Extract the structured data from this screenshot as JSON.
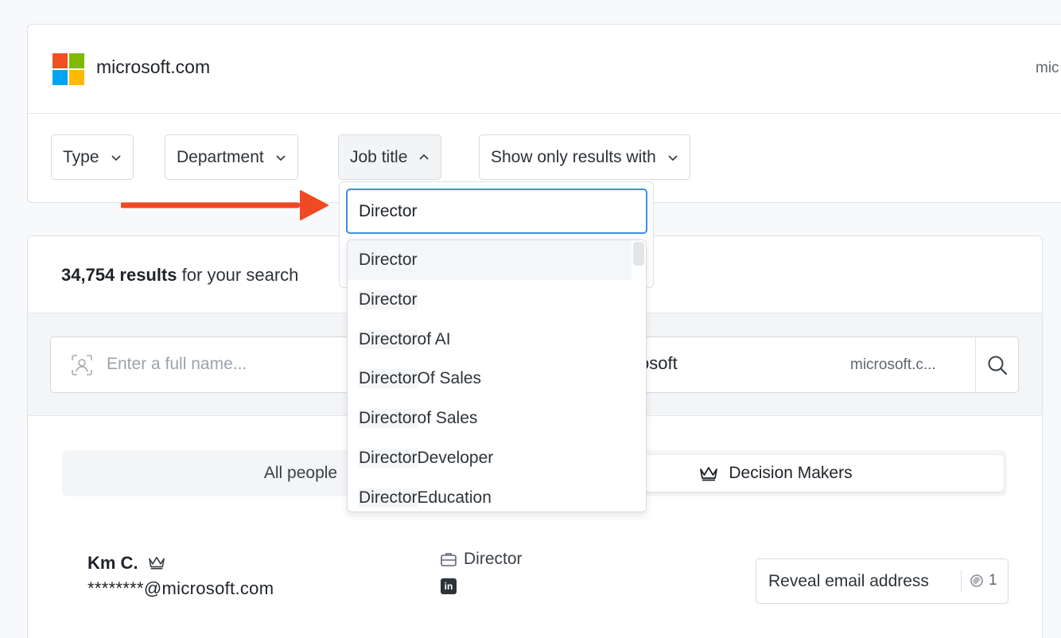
{
  "company": {
    "name": "microsoft.com",
    "domain_truncated": "mic",
    "logo_colors": [
      "#f25022",
      "#7fba00",
      "#00a4ef",
      "#ffb900"
    ]
  },
  "filters": {
    "type": "Type",
    "department": "Department",
    "job_title": "Job title",
    "show_only": "Show only results with"
  },
  "results": {
    "count": "34,754 results",
    "suffix": " for your search"
  },
  "search": {
    "name_placeholder": "Enter a full name...",
    "company_value": "osoft",
    "domain_value": "microsoft.c..."
  },
  "tabs": {
    "all": "All people",
    "decision_makers": "Decision Makers"
  },
  "person": {
    "name": "Km C.",
    "email": "********@microsoft.com",
    "title": "Director",
    "linkedin": "in",
    "reveal_label": "Reveal email address",
    "credit_cost": "1"
  },
  "job_title_dropdown": {
    "search_value": "Director",
    "options": [
      {
        "match": "Director",
        "rest": ""
      },
      {
        "match": "Director",
        "rest": ""
      },
      {
        "match": "Director",
        "rest": " of AI"
      },
      {
        "match": "Director",
        "rest": " Of Sales"
      },
      {
        "match": "Director",
        "rest": " of Sales"
      },
      {
        "match": "Director",
        "rest": " Developer"
      },
      {
        "match": "Director",
        "rest": " Education"
      }
    ]
  },
  "colors": {
    "accent_focus": "#3b8fe0",
    "annotation_arrow": "#f04a23"
  }
}
